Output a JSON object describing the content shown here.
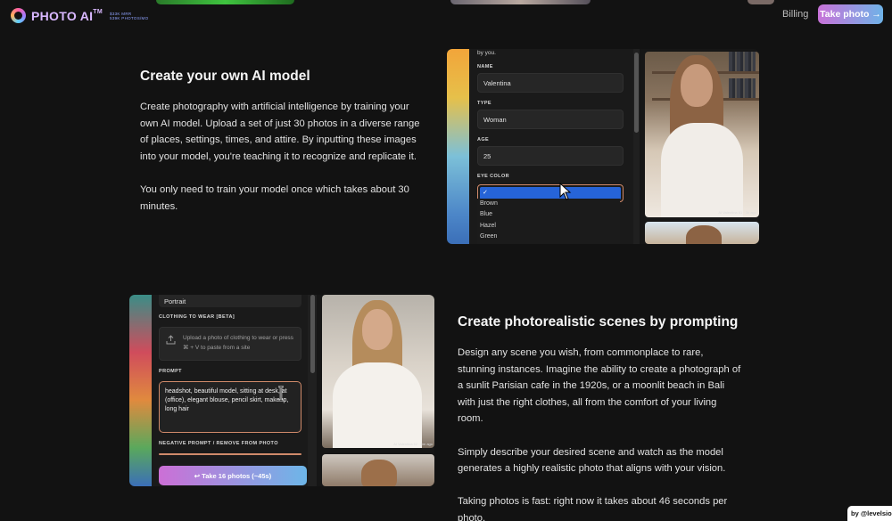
{
  "header": {
    "logo_text": "PHOTO AI",
    "logo_tm": "TM",
    "stats_line1": "$33K MRR",
    "stats_line2": "539K PHOTOS/MO",
    "billing_label": "Billing",
    "take_photo_label": "Take photo →"
  },
  "section1": {
    "title": "Create your own AI model",
    "paragraphs": [
      "Create photography with artificial intelligence by training your own AI model. Upload a set of just 30 photos in a diverse range of places, settings, times, and attire. By inputting these images into your model, you're teaching it to recognize and replicate it.",
      "You only need to train your model once which takes about 30 minutes."
    ],
    "screenshot": {
      "intro_text": "by you.",
      "name_label": "NAME",
      "name_value": "Valentina",
      "type_label": "TYPE",
      "type_value": "Woman",
      "age_label": "AGE",
      "age_value": "25",
      "eye_color_label": "EYE COLOR",
      "eye_selected": "✓",
      "eye_options": [
        "Brown",
        "Blue",
        "Hazel",
        "Green"
      ],
      "photo_tag": "AI Valentina 61 · 3h ago"
    }
  },
  "section2": {
    "title": "Create photorealistic scenes by prompting",
    "paragraphs": [
      "Design any scene you wish, from commonplace to rare, stunning instances. Imagine the ability to create a photograph of a sunlit Parisian cafe in the 1920s, or a moonlit beach in Bali with just the right clothes, all from the comfort of your living room.",
      "Simply describe your desired scene and watch as the model generates a highly realistic photo that aligns with your vision.",
      "Taking photos is fast: right now it takes about 46 seconds per photo."
    ],
    "screenshot": {
      "style_value": "Portrait",
      "clothing_label": "CLOTHING TO WEAR [BETA]",
      "upload_text": "Upload a photo of clothing to wear or press ⌘ + V to paste from a site",
      "prompt_label": "PROMPT",
      "prompt_value": "headshot, beautiful model, sitting at desk, at (office), elegant blouse, pencil skirt, makeup, long hair",
      "negative_label": "NEGATIVE PROMPT / REMOVE FROM PHOTO",
      "take_button": "↩ Take 16 photos (~45s)",
      "photo_tag": "AI Valentina 62 · 5m ago"
    }
  },
  "footer": {
    "credit": "by @levelsio"
  },
  "colors": {
    "background": "#121212",
    "accent_gradient_start": "#c872d8",
    "accent_gradient_end": "#6fb3e8",
    "select_highlight": "#2664d8",
    "focus_border": "#d08a6a"
  }
}
